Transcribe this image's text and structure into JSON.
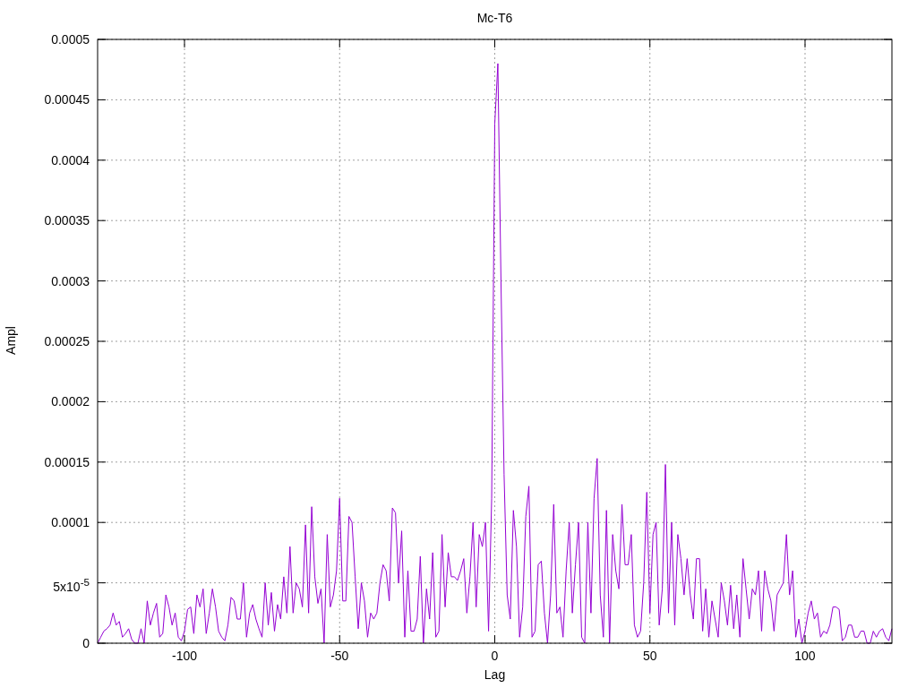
{
  "chart_data": {
    "type": "line",
    "title": "Mc-T6",
    "xlabel": "Lag",
    "ylabel": "Ampl",
    "xlim": [
      -128,
      128
    ],
    "ylim": [
      0,
      0.0005
    ],
    "xticks": [
      -100,
      -50,
      0,
      50,
      100
    ],
    "yticks": [
      0,
      {
        "value": 5e-05,
        "label": "5x10$^{-5}$"
      },
      {
        "value": 0.0001,
        "label": "0.0001"
      },
      {
        "value": 0.00015,
        "label": "0.00015"
      },
      {
        "value": 0.0002,
        "label": "0.0002"
      },
      {
        "value": 0.00025,
        "label": "0.00025"
      },
      {
        "value": 0.0003,
        "label": "0.0003"
      },
      {
        "value": 0.00035,
        "label": "0.00035"
      },
      {
        "value": 0.0004,
        "label": "0.0004"
      },
      {
        "value": 0.00045,
        "label": "0.00045"
      },
      {
        "value": 0.0005,
        "label": "0.0005"
      }
    ],
    "x": [
      -128,
      -127,
      -126,
      -125,
      -124,
      -123,
      -122,
      -121,
      -120,
      -119,
      -118,
      -117,
      -116,
      -115,
      -114,
      -113,
      -112,
      -111,
      -110,
      -109,
      -108,
      -107,
      -106,
      -105,
      -104,
      -103,
      -102,
      -101,
      -100,
      -99,
      -98,
      -97,
      -96,
      -95,
      -94,
      -93,
      -92,
      -91,
      -90,
      -89,
      -88,
      -87,
      -86,
      -85,
      -84,
      -83,
      -82,
      -81,
      -80,
      -79,
      -78,
      -77,
      -76,
      -75,
      -74,
      -73,
      -72,
      -71,
      -70,
      -69,
      -68,
      -67,
      -66,
      -65,
      -64,
      -63,
      -62,
      -61,
      -60,
      -59,
      -58,
      -57,
      -56,
      -55,
      -54,
      -53,
      -52,
      -51,
      -50,
      -49,
      -48,
      -47,
      -46,
      -45,
      -44,
      -43,
      -42,
      -41,
      -40,
      -39,
      -38,
      -37,
      -36,
      -35,
      -34,
      -33,
      -32,
      -31,
      -30,
      -29,
      -28,
      -27,
      -26,
      -25,
      -24,
      -23,
      -22,
      -21,
      -20,
      -19,
      -18,
      -17,
      -16,
      -15,
      -14,
      -13,
      -12,
      -11,
      -10,
      -9,
      -8,
      -7,
      -6,
      -5,
      -4,
      -3,
      -2,
      -1,
      0,
      1,
      2,
      3,
      4,
      5,
      6,
      7,
      8,
      9,
      10,
      11,
      12,
      13,
      14,
      15,
      16,
      17,
      18,
      19,
      20,
      21,
      22,
      23,
      24,
      25,
      26,
      27,
      28,
      29,
      30,
      31,
      32,
      33,
      34,
      35,
      36,
      37,
      38,
      39,
      40,
      41,
      42,
      43,
      44,
      45,
      46,
      47,
      48,
      49,
      50,
      51,
      52,
      53,
      54,
      55,
      56,
      57,
      58,
      59,
      60,
      61,
      62,
      63,
      64,
      65,
      66,
      67,
      68,
      69,
      70,
      71,
      72,
      73,
      74,
      75,
      76,
      77,
      78,
      79,
      80,
      81,
      82,
      83,
      84,
      85,
      86,
      87,
      88,
      89,
      90,
      91,
      92,
      93,
      94,
      95,
      96,
      97,
      98,
      99,
      100,
      101,
      102,
      103,
      104,
      105,
      106,
      107,
      108,
      109,
      110,
      111,
      112,
      113,
      114,
      115,
      116,
      117,
      118,
      119,
      120,
      121,
      122,
      123,
      124,
      125,
      126,
      127,
      128
    ],
    "grid": true,
    "series": [
      {
        "color": "#9400d3",
        "values": [
          0,
          5e-06,
          1e-05,
          1.2e-05,
          1.5e-05,
          2.5e-05,
          1.5e-05,
          1.8e-05,
          5e-06,
          8e-06,
          1.2e-05,
          3e-06,
          0,
          0,
          1.2e-05,
          0,
          3.5e-05,
          1.5e-05,
          2.5e-05,
          3.3e-05,
          5e-06,
          8e-06,
          4e-05,
          3e-05,
          1.5e-05,
          2.5e-05,
          5e-06,
          2e-06,
          1e-05,
          2.8e-05,
          3e-05,
          8e-06,
          4e-05,
          3e-05,
          4.5e-05,
          8e-06,
          2.5e-05,
          4.5e-05,
          3e-05,
          1e-05,
          5e-06,
          2e-06,
          1.5e-05,
          3.8e-05,
          3.5e-05,
          2e-05,
          2e-05,
          5e-05,
          5e-06,
          2.5e-05,
          3.2e-05,
          2e-05,
          1.2e-05,
          5e-06,
          5e-05,
          1.5e-05,
          4.2e-05,
          1e-05,
          3.2e-05,
          2e-05,
          5.5e-05,
          2.5e-05,
          8e-05,
          2.5e-05,
          5e-05,
          4.5e-05,
          3e-05,
          9.8e-05,
          2.5e-05,
          0.000113,
          5.5e-05,
          3.3e-05,
          4.5e-05,
          0,
          9e-05,
          3e-05,
          4e-05,
          6e-05,
          0.00012,
          3.5e-05,
          3.5e-05,
          0.000105,
          0.0001,
          5.5e-05,
          1.2e-05,
          5e-05,
          3.5e-05,
          5e-06,
          2.5e-05,
          2e-05,
          2.5e-05,
          5e-05,
          6.5e-05,
          6e-05,
          3.5e-05,
          0.000112,
          0.000108,
          5e-05,
          9.3e-05,
          5e-06,
          6e-05,
          1e-05,
          1e-05,
          2e-05,
          7.2e-05,
          0,
          4.5e-05,
          2e-05,
          7.5e-05,
          5e-06,
          1e-05,
          9e-05,
          3e-05,
          7.5e-05,
          5.5e-05,
          5.5e-05,
          5.2e-05,
          6e-05,
          7e-05,
          2.5e-05,
          5.5e-05,
          0.0001,
          3e-05,
          9e-05,
          8e-05,
          0.0001,
          1e-05,
          0.00012,
          0.00043,
          0.00048,
          0.0003,
          0.00014,
          4e-05,
          2e-05,
          0.00011,
          8e-05,
          5e-06,
          3e-05,
          0.000105,
          0.00013,
          5e-06,
          1e-05,
          6.5e-05,
          6.8e-05,
          2.5e-05,
          0,
          4e-05,
          0.000115,
          2.5e-05,
          3e-05,
          5e-06,
          6e-05,
          0.0001,
          2.5e-05,
          6.5e-05,
          0.0001,
          5e-06,
          0,
          0.0001,
          2.5e-05,
          0.00012,
          0.000153,
          4e-05,
          5e-06,
          0.00011,
          0,
          9e-05,
          6e-05,
          4.5e-05,
          0.000115,
          6.5e-05,
          6.5e-05,
          9e-05,
          1.5e-05,
          5e-06,
          1e-05,
          5e-05,
          0.000125,
          2.5e-05,
          9e-05,
          0.0001,
          1.5e-05,
          4.5e-05,
          0.000148,
          2.5e-05,
          0.0001,
          1.5e-05,
          9e-05,
          7e-05,
          4e-05,
          7e-05,
          4e-05,
          2e-05,
          7e-05,
          7e-05,
          1e-05,
          4.5e-05,
          5e-06,
          3.5e-05,
          2e-05,
          5e-06,
          5e-05,
          3.5e-05,
          1.5e-05,
          4.8e-05,
          1.2e-05,
          4e-05,
          5e-06,
          7e-05,
          4.5e-05,
          2e-05,
          4.5e-05,
          4e-05,
          6e-05,
          1e-05,
          6e-05,
          4.5e-05,
          3.5e-05,
          1e-05,
          4e-05,
          4.5e-05,
          5e-05,
          9e-05,
          4e-05,
          6e-05,
          5e-06,
          2e-05,
          0,
          1e-05,
          2.5e-05,
          3.5e-05,
          2e-05,
          2.5e-05,
          5e-06,
          1e-05,
          8e-06,
          1.5e-05,
          3e-05,
          3e-05,
          2.8e-05,
          2e-06,
          5e-06,
          1.5e-05,
          1.5e-05,
          5e-06,
          5e-06,
          1e-05,
          1e-05,
          0,
          0,
          1e-05,
          5e-06,
          1e-05,
          1.2e-05,
          5e-06,
          2e-06,
          1.2e-05
        ]
      }
    ]
  }
}
